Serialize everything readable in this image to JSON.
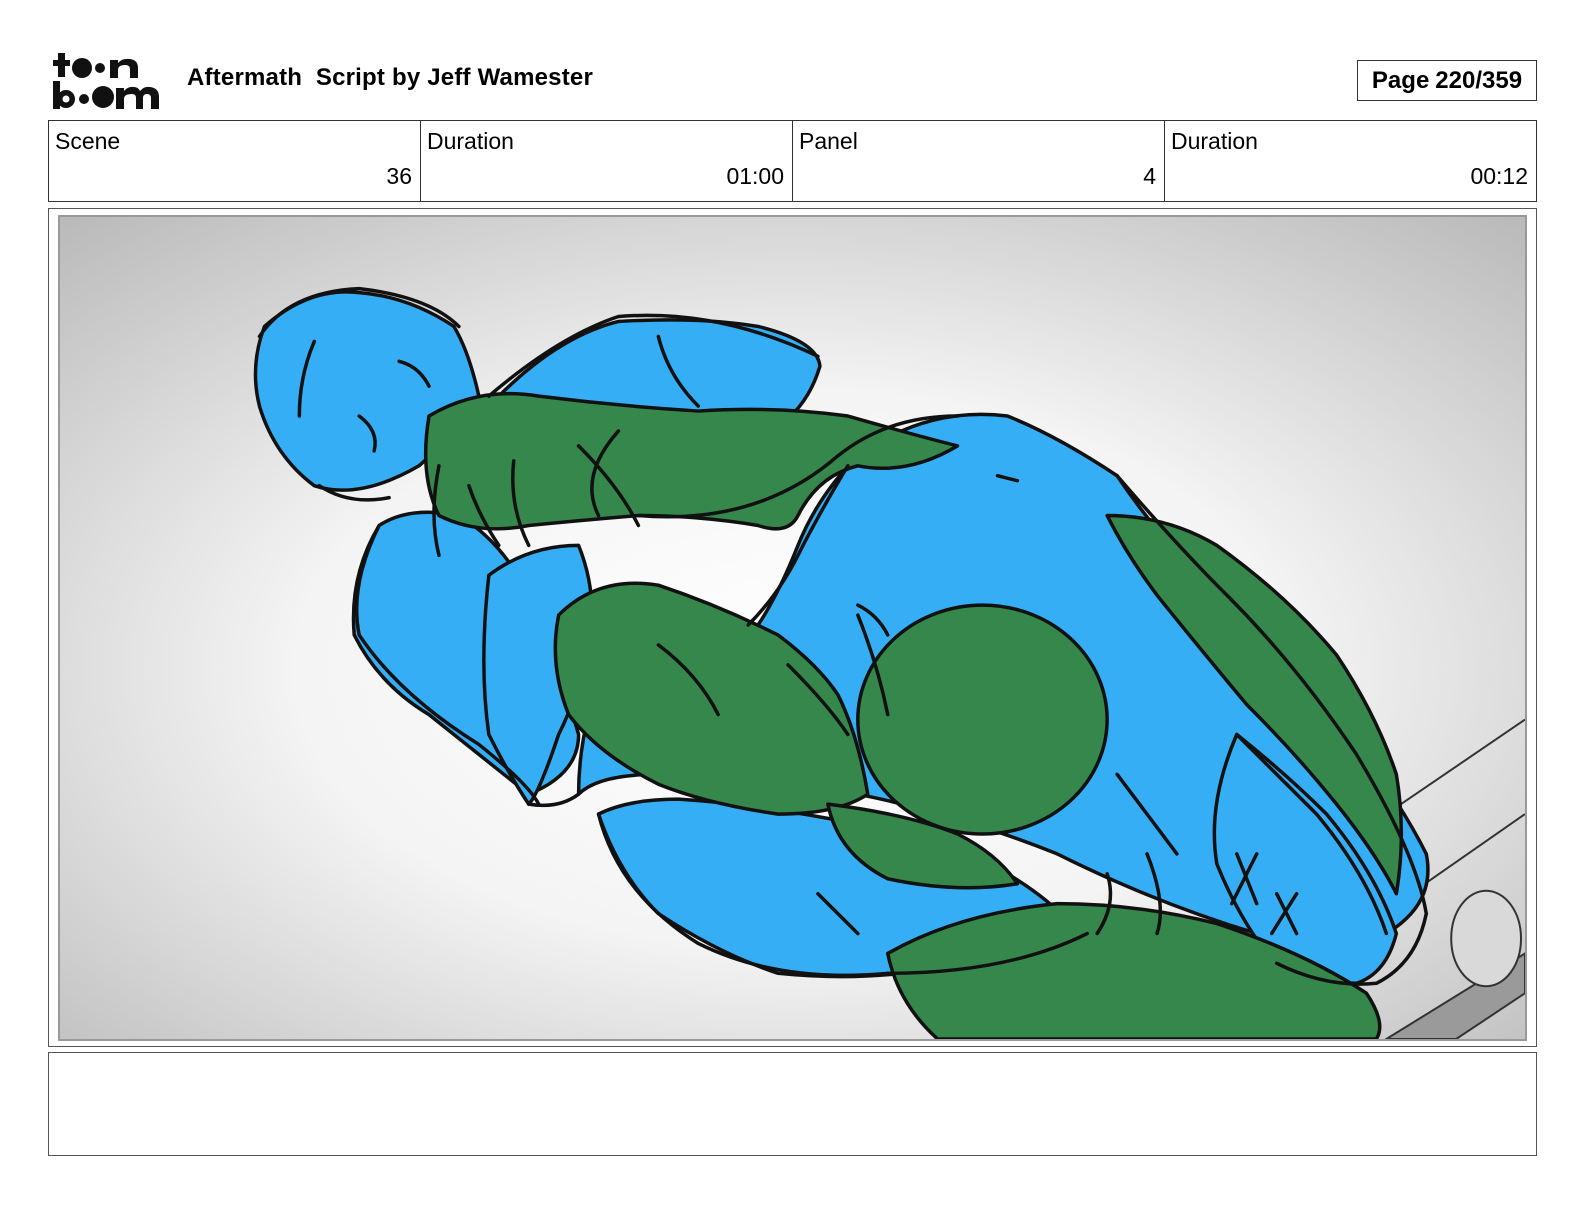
{
  "header": {
    "logo_name": "toon-boom-logo",
    "title": "Aftermath  Script by Jeff Wamester",
    "page_label": "Page",
    "page_number": "220/359"
  },
  "info": {
    "scene_label": "Scene",
    "scene_value": "36",
    "scene_duration_label": "Duration",
    "scene_duration_value": "01:00",
    "panel_label": "Panel",
    "panel_value": "4",
    "panel_duration_label": "Duration",
    "panel_duration_value": "00:12"
  },
  "panel": {
    "colors": {
      "blue_figure": "#35aef5",
      "green_figure": "#36874c",
      "outline": "#111111",
      "background_center": "#ffffff",
      "background_edge": "#b8b8b8"
    }
  },
  "notes": {
    "text": ""
  }
}
